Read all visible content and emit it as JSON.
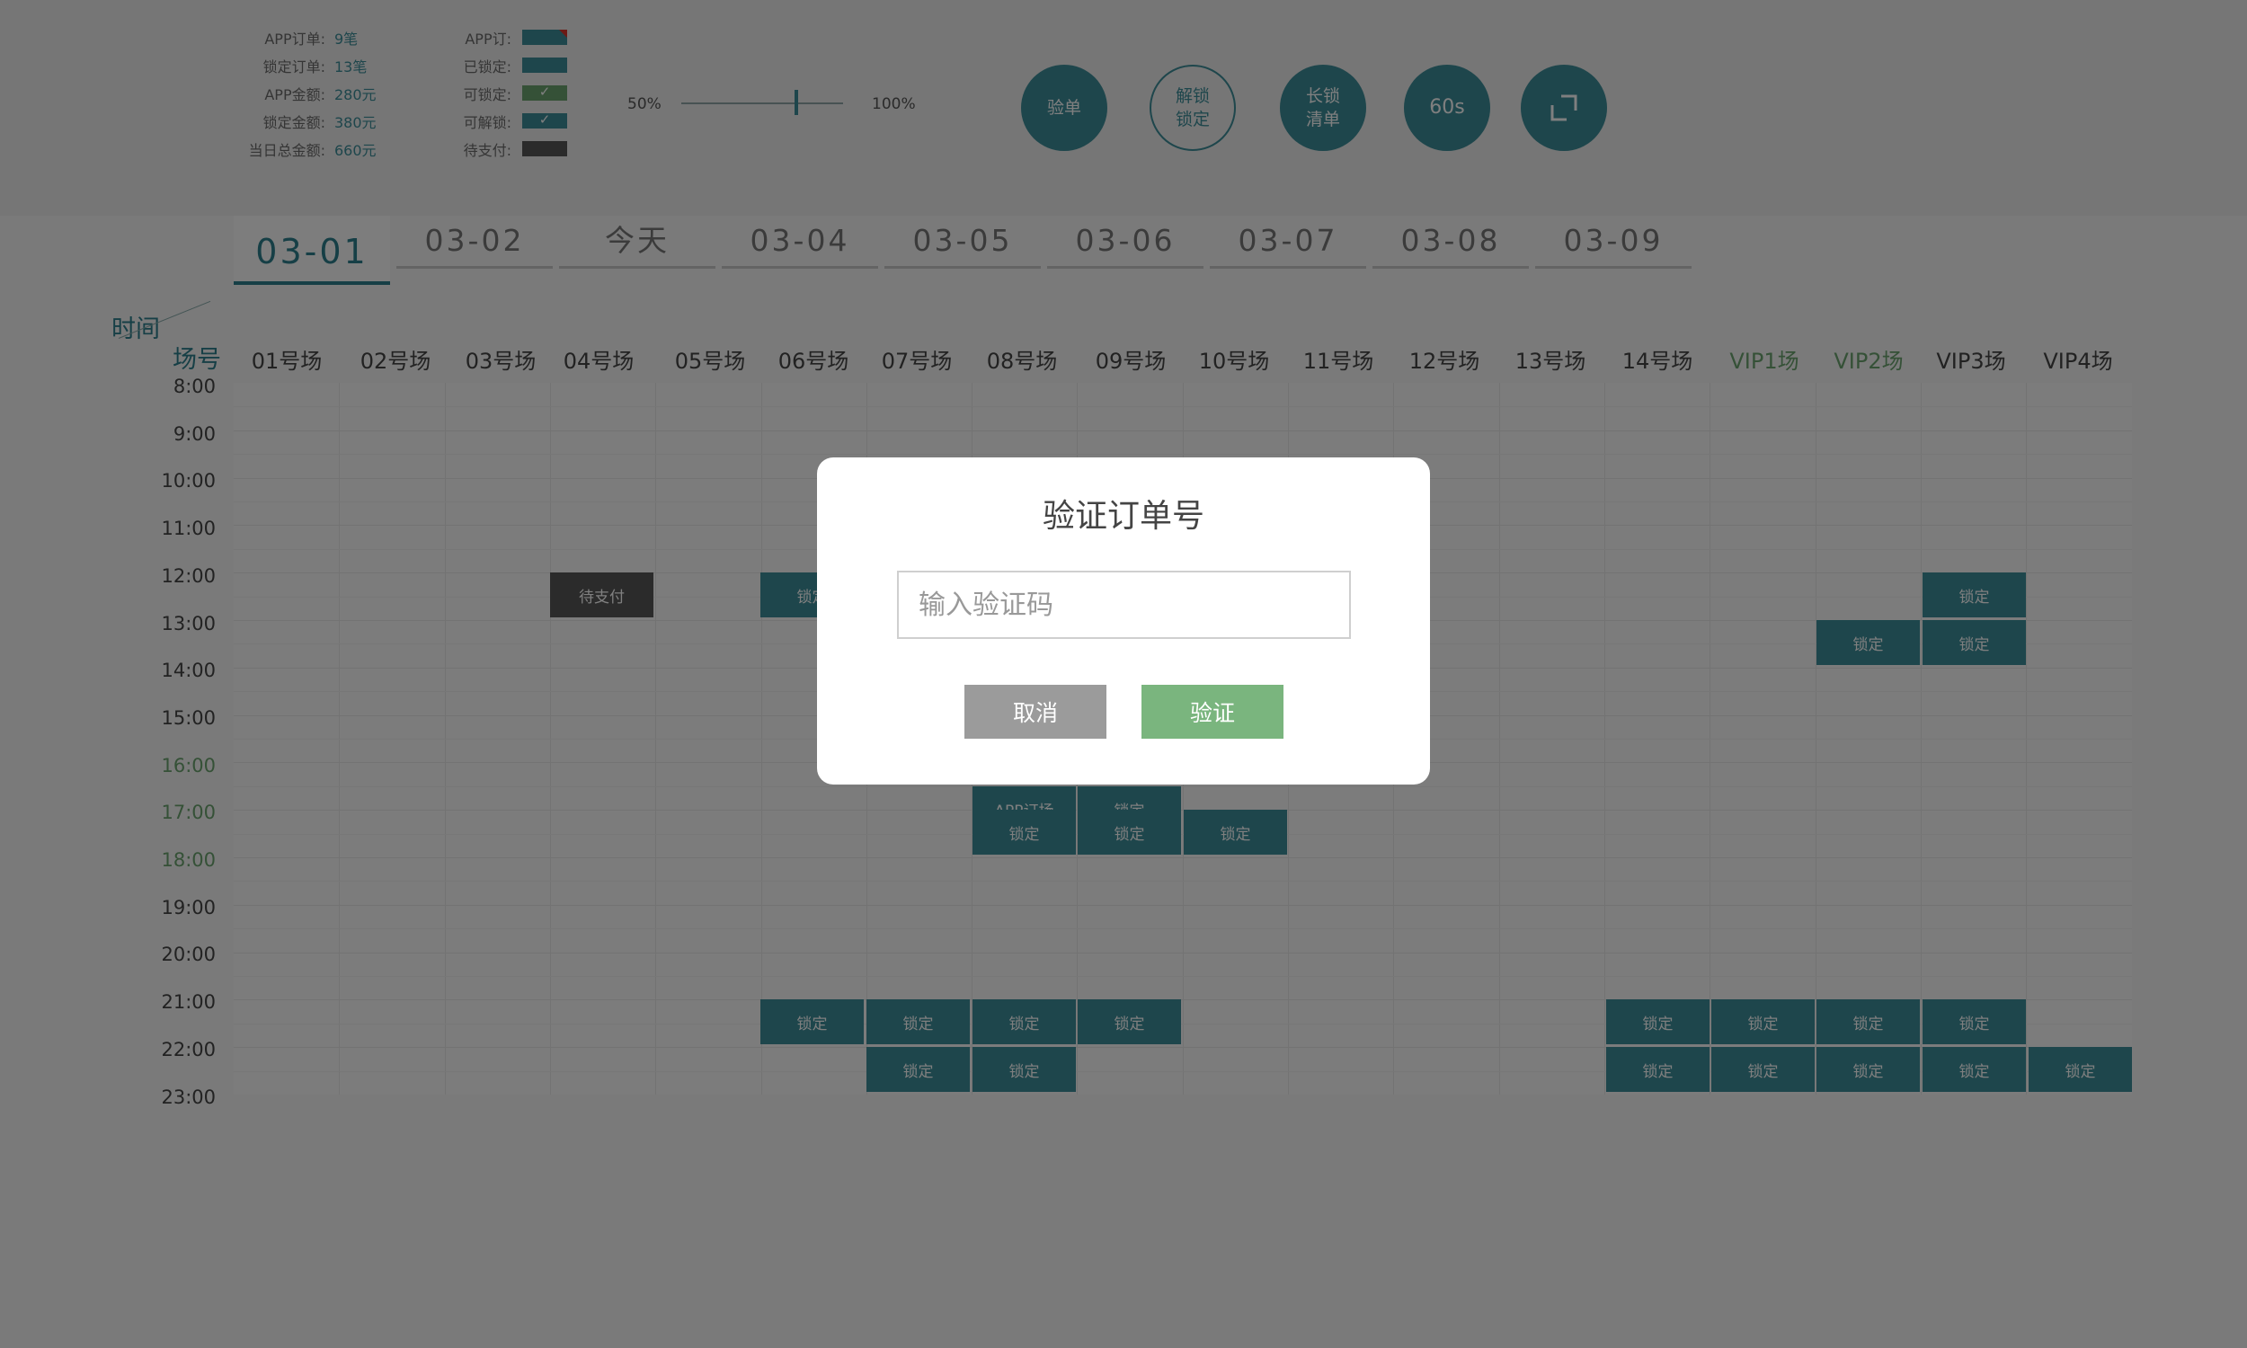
{
  "stats": [
    {
      "label": "APP订单:",
      "value": "9笔"
    },
    {
      "label": "锁定订单:",
      "value": "13笔"
    },
    {
      "label": "APP金额:",
      "value": "280元"
    },
    {
      "label": "锁定金额:",
      "value": "380元"
    },
    {
      "label": "当日总金额:",
      "value": "660元"
    }
  ],
  "legend": [
    {
      "label": "APP订:",
      "swatch": "app"
    },
    {
      "label": "已锁定:",
      "swatch": "locked"
    },
    {
      "label": "可锁定:",
      "swatch": "lockable"
    },
    {
      "label": "可解锁:",
      "swatch": "unlockable"
    },
    {
      "label": "待支付:",
      "swatch": "pending"
    }
  ],
  "zoom": {
    "min_label": "50%",
    "max_label": "100%",
    "level_fraction": 0.7
  },
  "toolbar": {
    "verify": "验单",
    "unlock_line1": "解锁",
    "unlock_line2": "锁定",
    "longlock_line1": "长锁",
    "longlock_line2": "清单",
    "timer": "60s",
    "fullscreen_icon": "expand-icon"
  },
  "tabs": [
    "03-01",
    "03-02",
    "今天",
    "03-04",
    "03-05",
    "03-06",
    "03-07",
    "03-08",
    "03-09"
  ],
  "active_tab": 0,
  "grid": {
    "corner_time": "时间",
    "corner_court": "场号",
    "courts": [
      "01号场",
      "02号场",
      "03号场",
      "04号场",
      "05号场",
      "06号场",
      "07号场",
      "08号场",
      "09号场",
      "10号场",
      "11号场",
      "12号场",
      "13号场",
      "14号场",
      "VIP1场",
      "VIP2场",
      "VIP3场",
      "VIP4场"
    ],
    "green_courts": [
      "VIP1场",
      "VIP2场"
    ],
    "times": [
      "8:00",
      "9:00",
      "10:00",
      "11:00",
      "12:00",
      "13:00",
      "14:00",
      "15:00",
      "16:00",
      "17:00",
      "18:00",
      "19:00",
      "20:00",
      "21:00",
      "22:00",
      "23:00"
    ],
    "green_times": [
      "16:00",
      "17:00",
      "18:00"
    ],
    "bookings": [
      {
        "court": 3,
        "row": 8,
        "label": "待支付",
        "status": "pending"
      },
      {
        "court": 5,
        "row": 8,
        "label": "锁定",
        "status": "locked"
      },
      {
        "court": 16,
        "row": 8,
        "label": "锁定",
        "status": "locked"
      },
      {
        "court": 15,
        "row": 10,
        "label": "锁定",
        "status": "locked"
      },
      {
        "court": 16,
        "row": 10,
        "label": "锁定",
        "status": "locked"
      },
      {
        "court": 7,
        "row": 17,
        "label": "APP订场",
        "status": "app"
      },
      {
        "court": 8,
        "row": 17,
        "label": "锁定",
        "status": "locked"
      },
      {
        "court": 7,
        "row": 18,
        "label": "锁定",
        "status": "locked"
      },
      {
        "court": 8,
        "row": 18,
        "label": "锁定",
        "status": "locked"
      },
      {
        "court": 9,
        "row": 18,
        "label": "锁定",
        "status": "locked"
      },
      {
        "court": 5,
        "row": 26,
        "label": "锁定",
        "status": "locked"
      },
      {
        "court": 6,
        "row": 26,
        "label": "锁定",
        "status": "locked"
      },
      {
        "court": 7,
        "row": 26,
        "label": "锁定",
        "status": "locked"
      },
      {
        "court": 8,
        "row": 26,
        "label": "锁定",
        "status": "locked"
      },
      {
        "court": 13,
        "row": 26,
        "label": "锁定",
        "status": "locked"
      },
      {
        "court": 14,
        "row": 26,
        "label": "锁定",
        "status": "locked"
      },
      {
        "court": 15,
        "row": 26,
        "label": "锁定",
        "status": "locked"
      },
      {
        "court": 16,
        "row": 26,
        "label": "锁定",
        "status": "locked"
      },
      {
        "court": 6,
        "row": 28,
        "label": "锁定",
        "status": "locked"
      },
      {
        "court": 7,
        "row": 28,
        "label": "锁定",
        "status": "locked"
      },
      {
        "court": 13,
        "row": 28,
        "label": "锁定",
        "status": "locked"
      },
      {
        "court": 14,
        "row": 28,
        "label": "锁定",
        "status": "locked"
      },
      {
        "court": 15,
        "row": 28,
        "label": "锁定",
        "status": "locked"
      },
      {
        "court": 16,
        "row": 28,
        "label": "锁定",
        "status": "locked"
      },
      {
        "court": 17,
        "row": 28,
        "label": "锁定",
        "status": "locked"
      }
    ]
  },
  "modal": {
    "title": "验证订单号",
    "input_placeholder": "输入验证码",
    "input_value": "",
    "cancel_label": "取消",
    "confirm_label": "验证"
  },
  "colors": {
    "accent": "#3c8d98",
    "green": "#7ab57e",
    "pending": "#575757",
    "overlay": "rgba(0,0,0,0.5)"
  }
}
